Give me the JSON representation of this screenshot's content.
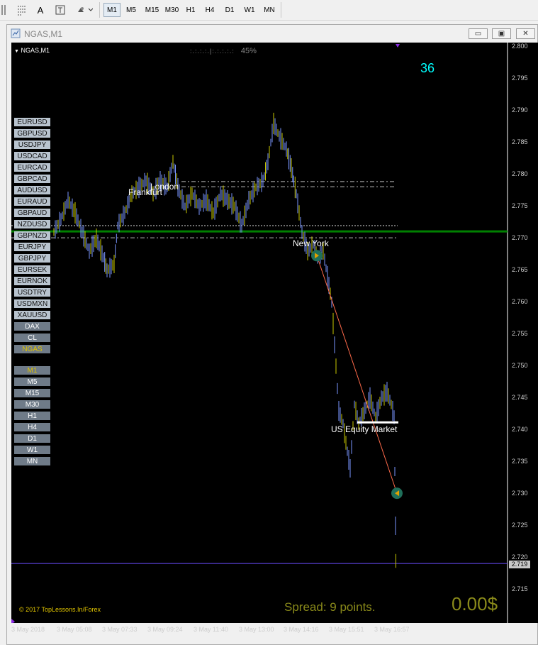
{
  "toolbar": {
    "icons": [
      "period-sep-icon",
      "text-A-icon",
      "text-label-icon",
      "shapes-icon"
    ],
    "a_label": "A",
    "timeframes": [
      "M1",
      "M5",
      "M15",
      "M30",
      "H1",
      "H4",
      "D1",
      "W1",
      "MN"
    ],
    "active_timeframe": "M1"
  },
  "window": {
    "title": "NGAS,M1",
    "minimize": "▭",
    "restore": "▣",
    "close": "✕"
  },
  "chart": {
    "symbol_label": "NGAS,M1",
    "progress_text": "45%",
    "progress_value": 45,
    "counter": "36",
    "copyright": "© 2017 TopLessons.In/Forex",
    "spread": "Spread: 9 points.",
    "profit": "0.00$",
    "session_labels": {
      "frankfurt": "Frankfurt",
      "london": "London",
      "new_york": "New York",
      "us_equity": "US Equity Market"
    },
    "current_price": "2.719",
    "price_labels": [
      "2.800",
      "2.795",
      "2.790",
      "2.785",
      "2.780",
      "2.775",
      "2.770",
      "2.765",
      "2.760",
      "2.755",
      "2.750",
      "2.745",
      "2.740",
      "2.735",
      "2.730",
      "2.725",
      "2.720",
      "2.715"
    ],
    "time_labels": [
      "3 May 2018",
      "3 May 05:08",
      "3 May 07:33",
      "3 May 09:24",
      "3 May 11:40",
      "3 May 13:00",
      "3 May 14:16",
      "3 May 15:51",
      "3 May 16:57"
    ],
    "colors": {
      "bull": "#7a96ff",
      "bear": "#c8c800",
      "support": "#008000",
      "price_line": "#6a4cff",
      "accent": "#00ffff"
    }
  },
  "symbols": [
    "EURUSD",
    "GBPUSD",
    "USDJPY",
    "USDCAD",
    "EURCAD",
    "GBPCAD",
    "AUDUSD",
    "EURAUD",
    "GBPAUD",
    "NZDUSD",
    "GBPNZD",
    "EURJPY",
    "GBPJPY",
    "EURSEK",
    "EURNOK",
    "USDTRY",
    "USDMXN",
    "XAUUSD",
    "DAX",
    "CL",
    "NGAS"
  ],
  "selected_symbol": "NGAS",
  "periods": [
    "M1",
    "M5",
    "M15",
    "M30",
    "H1",
    "H4",
    "D1",
    "W1",
    "MN"
  ],
  "selected_period": "M1"
}
